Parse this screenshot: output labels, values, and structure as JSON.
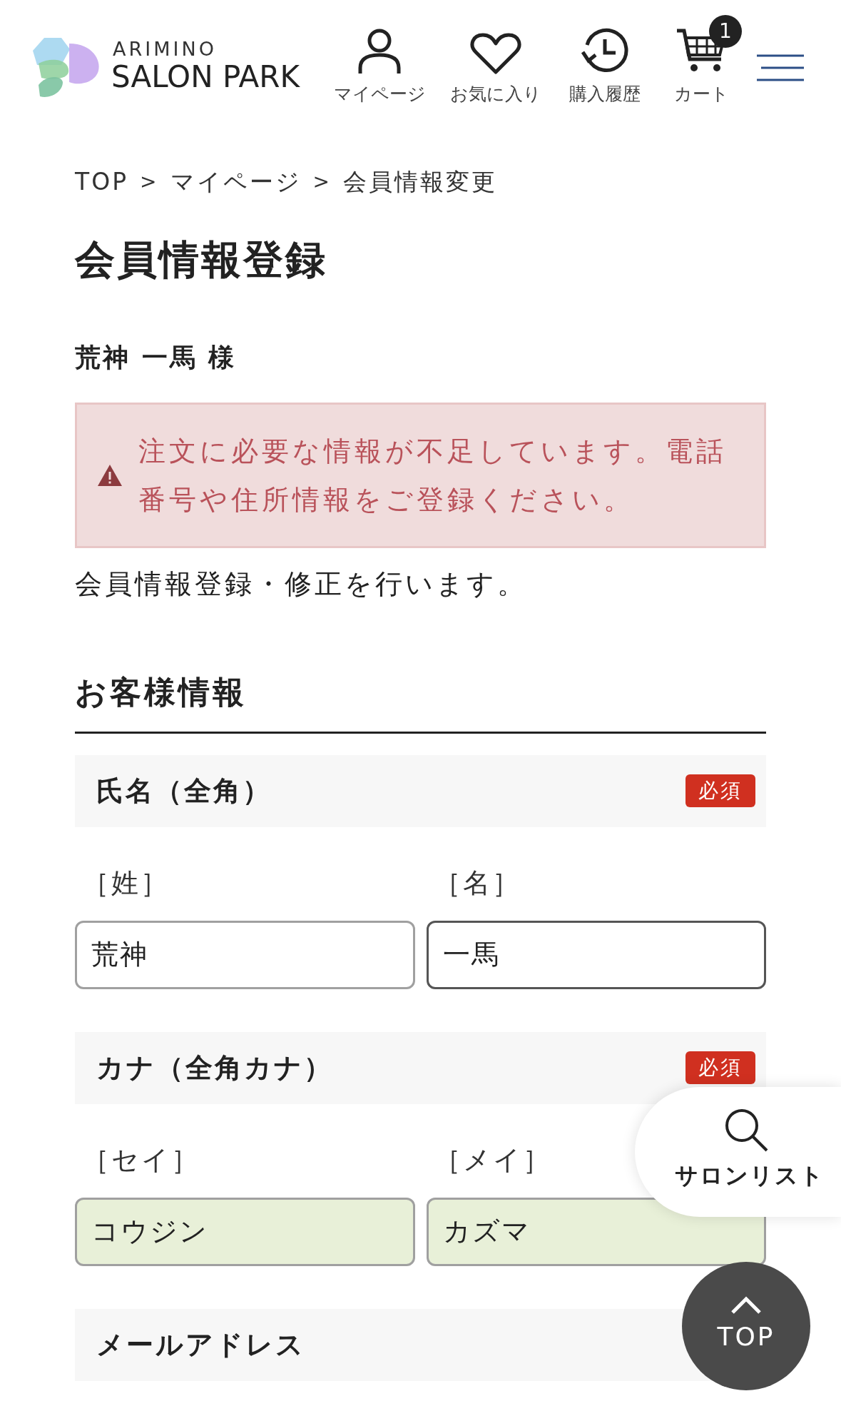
{
  "header": {
    "logo_top": "ARIMINO",
    "logo_bottom": "SALON PARK",
    "nav": [
      {
        "kind": "user",
        "label": "マイページ"
      },
      {
        "kind": "heart",
        "label": "お気に入り"
      },
      {
        "kind": "history",
        "label": "購入履歴"
      },
      {
        "kind": "cart",
        "label": "カート",
        "badge": "1"
      }
    ]
  },
  "breadcrumb": [
    {
      "kind": "link",
      "text": "TOP"
    },
    {
      "kind": "separator",
      "text": ">"
    },
    {
      "kind": "link",
      "text": "マイページ"
    },
    {
      "kind": "separator",
      "text": ">"
    },
    {
      "kind": "current",
      "text": "会員情報変更"
    }
  ],
  "title": "会員情報登録",
  "member_name": "荒神 一馬 様",
  "alert": "注文に必要な情報が不足しています。電話番号や住所情報をご登録ください。",
  "intro": "会員情報登録・修正を行います。",
  "section_title": "お客様情報",
  "field_groups": [
    {
      "label": "氏名（全角）",
      "required": "必須",
      "fields": [
        {
          "label": "［姓］",
          "value": "荒神",
          "focused": false,
          "autofilled": false
        },
        {
          "label": "［名］",
          "value": "一馬",
          "focused": true,
          "autofilled": false
        }
      ]
    },
    {
      "label": "カナ（全角カナ）",
      "required": "必須",
      "fields": [
        {
          "label": "［セイ］",
          "value": "コウジン",
          "focused": false,
          "autofilled": true
        },
        {
          "label": "［メイ］",
          "value": "カズマ",
          "focused": false,
          "autofilled": true
        }
      ]
    },
    {
      "label": "メールアドレス"
    }
  ],
  "salon_list_button": "サロンリスト",
  "top_button": "TOP"
}
